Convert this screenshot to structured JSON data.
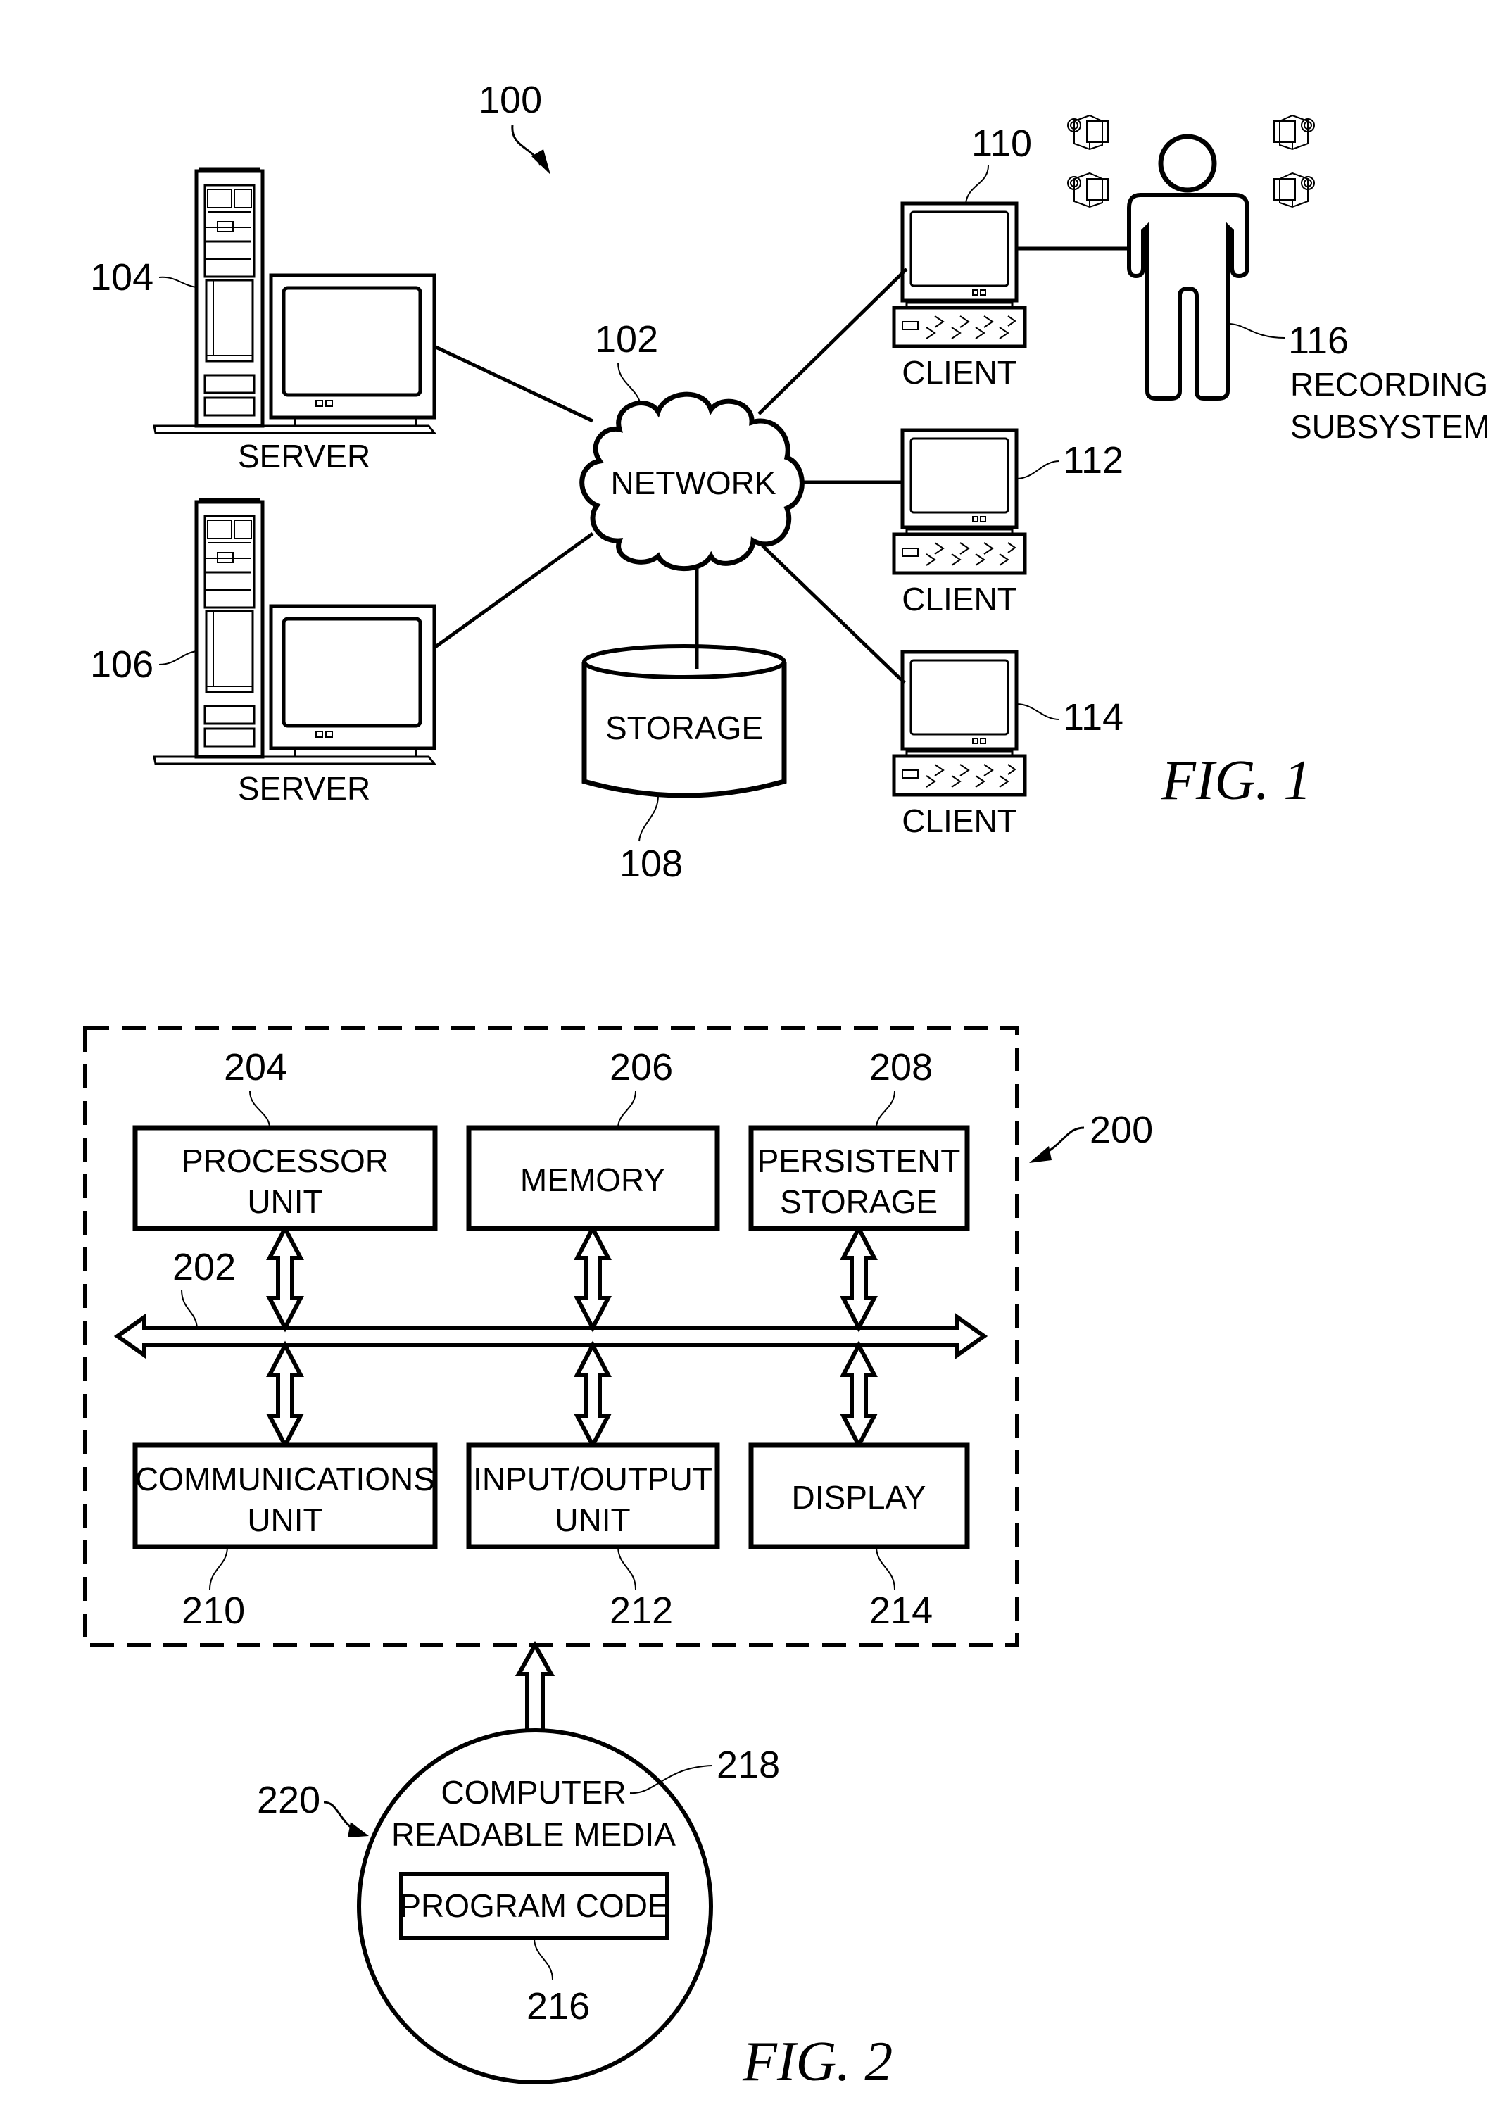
{
  "figure1": {
    "caption": "FIG. 1",
    "system_ref": "100",
    "network": {
      "ref": "102",
      "label": "NETWORK"
    },
    "servers": [
      {
        "ref": "104",
        "label": "SERVER"
      },
      {
        "ref": "106",
        "label": "SERVER"
      }
    ],
    "storage": {
      "ref": "108",
      "label": "STORAGE"
    },
    "clients": [
      {
        "ref": "110",
        "label": "CLIENT"
      },
      {
        "ref": "112",
        "label": "CLIENT"
      },
      {
        "ref": "114",
        "label": "CLIENT"
      }
    ],
    "recording_subsystem": {
      "ref": "116",
      "label_line1": "RECORDING",
      "label_line2": "SUBSYSTEM"
    }
  },
  "figure2": {
    "caption": "FIG. 2",
    "system_ref": "200",
    "bus_ref": "202",
    "top_units": [
      {
        "ref": "204",
        "line1": "PROCESSOR",
        "line2": "UNIT"
      },
      {
        "ref": "206",
        "line1": "MEMORY",
        "line2": ""
      },
      {
        "ref": "208",
        "line1": "PERSISTENT",
        "line2": "STORAGE"
      }
    ],
    "bottom_units": [
      {
        "ref": "210",
        "line1": "COMMUNICATIONS",
        "line2": "UNIT"
      },
      {
        "ref": "212",
        "line1": "INPUT/OUTPUT",
        "line2": "UNIT"
      },
      {
        "ref": "214",
        "line1": "DISPLAY",
        "line2": ""
      }
    ],
    "media": {
      "ref": "220",
      "media_ref": "218",
      "line1": "COMPUTER",
      "line2": "READABLE MEDIA",
      "program_code": "PROGRAM CODE",
      "program_ref": "216"
    }
  }
}
